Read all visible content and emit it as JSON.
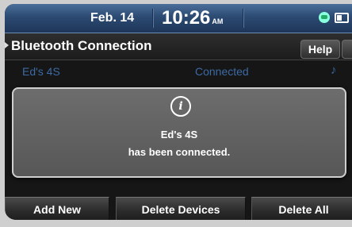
{
  "status_bar": {
    "date": "Feb. 14",
    "time": "10:26",
    "ampm": "AM"
  },
  "header": {
    "title": "Bluetooth Connection",
    "help_label": "Help"
  },
  "device": {
    "name": "Ed's 4S",
    "status": "Connected",
    "audio_icon": "music-note-icon"
  },
  "dialog": {
    "icon": "info-icon",
    "line1": "Ed's 4S",
    "line2": "has been connected."
  },
  "buttons": {
    "add_new": "Add New",
    "delete_devices": "Delete Devices",
    "delete_all": "Delete All"
  },
  "colors": {
    "status_bar": "#2c4a72",
    "device_text": "#3c6aa5",
    "dialog_bg": "#636363"
  }
}
